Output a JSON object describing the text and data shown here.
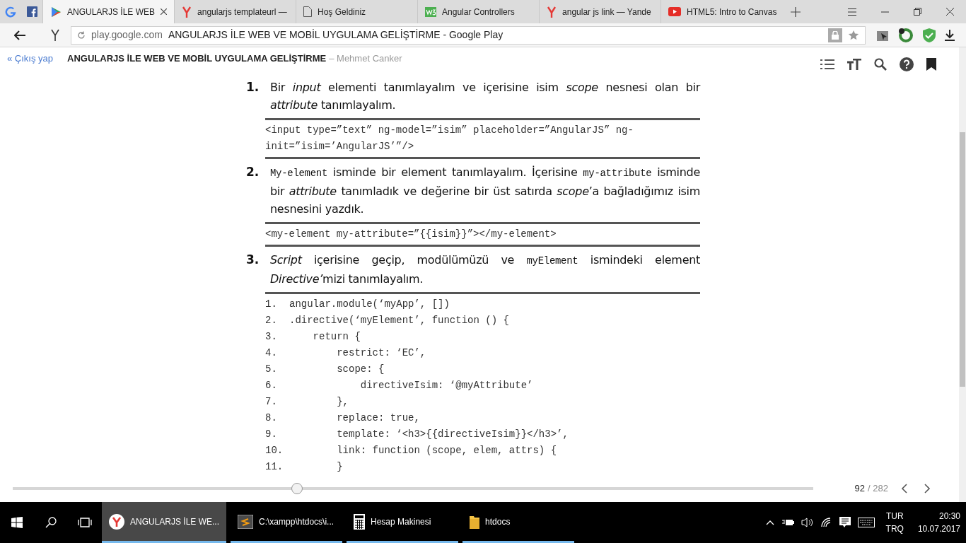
{
  "browser": {
    "tabs": [
      {
        "kind": "play",
        "title": "ANGULARJS İLE WEB",
        "selected": true
      },
      {
        "kind": "yandex",
        "title": "angularjs templateurl —",
        "selected": false
      },
      {
        "kind": "page",
        "title": "Hoş Geldiniz",
        "selected": false
      },
      {
        "kind": "w3",
        "title": "Angular Controllers",
        "selected": false
      },
      {
        "kind": "yandex",
        "title": "angular js link — Yande",
        "selected": false
      },
      {
        "kind": "youtube",
        "title": "HTML5: Intro to Canvas",
        "selected": false
      }
    ],
    "address": {
      "domain": "play.google.com",
      "page_title": "ANGULARJS İLE WEB VE MOBİL UYGULAMA GELİŞTİRME - Google Play"
    }
  },
  "reader": {
    "logout": "« Çıkış yap",
    "book_title": "ANGULARJS İLE WEB VE MOBİL UYGULAMA GELİŞTİRME",
    "author": "– Mehmet Canker",
    "steps": [
      {
        "number": "1.",
        "text": [
          {
            "kind": "plain",
            "text": "Bir "
          },
          {
            "kind": "italic",
            "text": "input"
          },
          {
            "kind": "plain",
            "text": " elementi tanımlayalım ve içerisine isim "
          },
          {
            "kind": "italic",
            "text": "scope"
          },
          {
            "kind": "plain",
            "text": " nesnesi olan bir "
          },
          {
            "kind": "italic",
            "text": "attribute"
          },
          {
            "kind": "plain",
            "text": " tanımlayalım."
          }
        ],
        "code": {
          "kind": "plain",
          "lines": [
            "<input type=”text” ng-model=”isim” placeholder=”AngularJS” ng-",
            "init=”isim=’AngularJS’”/>"
          ]
        }
      },
      {
        "number": "2.",
        "text": [
          {
            "kind": "mono",
            "text": "My-element"
          },
          {
            "kind": "plain",
            "text": " isminde bir element tanımlayalım. İçerisine "
          },
          {
            "kind": "mono",
            "text": "my-attribute"
          },
          {
            "kind": "plain",
            "text": " isminde bir "
          },
          {
            "kind": "italic",
            "text": "attribute"
          },
          {
            "kind": "plain",
            "text": " tanımladık ve değerine bir üst satırda "
          },
          {
            "kind": "italic",
            "text": "scope"
          },
          {
            "kind": "plain",
            "text": "’a bağladığımız isim nesnesini yazdık."
          }
        ],
        "code": {
          "kind": "plain",
          "lines": [
            "<my-element my-attribute=”{{isim}}”></my-element>"
          ]
        }
      },
      {
        "number": "3.",
        "text": [
          {
            "kind": "italic",
            "text": "Script"
          },
          {
            "kind": "plain",
            "text": " içerisine geçip, modülümüzü ve "
          },
          {
            "kind": "mono",
            "text": "myElement"
          },
          {
            "kind": "plain",
            "text": " ismindeki element "
          },
          {
            "kind": "italic",
            "text": "Directive’"
          },
          {
            "kind": "plain",
            "text": "mizi tanımlayalım."
          }
        ],
        "code": {
          "kind": "numbered",
          "lines": [
            {
              "number": "1.",
              "code": "angular.module(‘myApp’, [])"
            },
            {
              "number": "2.",
              "code": ".directive(‘myElement’, function () {"
            },
            {
              "number": "3.",
              "code": "    return {"
            },
            {
              "number": "4.",
              "code": "        restrict: ‘EC’,"
            },
            {
              "number": "5.",
              "code": "        scope: {"
            },
            {
              "number": "6.",
              "code": "            directiveIsim: ‘@myAttribute’"
            },
            {
              "number": "7.",
              "code": "        },"
            },
            {
              "number": "8.",
              "code": "        replace: true,"
            },
            {
              "number": "9.",
              "code": "        template: ‘<h3>{{directiveIsim}}</h3>’,"
            },
            {
              "number": "10.",
              "code": "        link: function (scope, elem, attrs) {"
            },
            {
              "number": "11.",
              "code": "        }"
            }
          ]
        }
      }
    ],
    "progress": {
      "level": 0.355,
      "page": "92",
      "total": "/ 282"
    }
  },
  "taskbar": {
    "apps": [
      {
        "kind": "yandex",
        "label": "ANGULARJS İLE WE...",
        "selected": true
      },
      {
        "kind": "sublime",
        "label": "C:\\xampp\\htdocs\\i...",
        "selected": false
      },
      {
        "kind": "calculator",
        "label": "Hesap Makinesi",
        "selected": false
      },
      {
        "kind": "folder",
        "label": "htdocs",
        "selected": false
      }
    ],
    "language": [
      "TUR",
      "TRQ"
    ],
    "time": "20:30",
    "date": "10.07.2017"
  }
}
